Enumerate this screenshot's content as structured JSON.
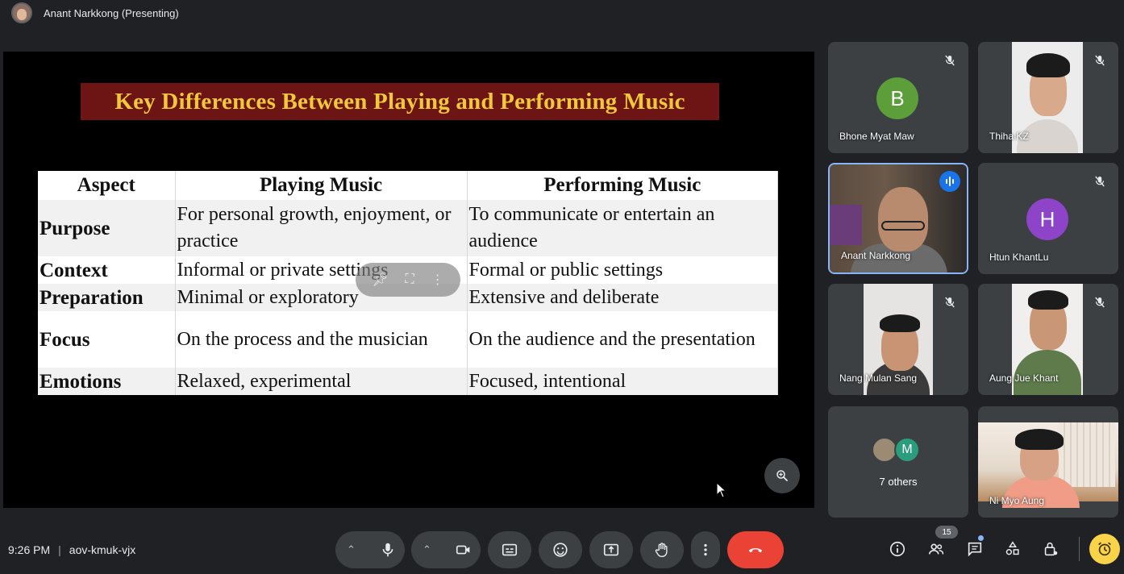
{
  "header": {
    "presenting_label": "Anant Narkkong (Presenting)"
  },
  "slide": {
    "title": "Key Differences Between Playing and Performing Music",
    "table": {
      "headers": [
        "Aspect",
        "Playing Music",
        "Performing Music"
      ],
      "rows": [
        {
          "aspect": "Purpose",
          "playing": "For personal growth, enjoyment, or practice",
          "performing": "To communicate or entertain an audience"
        },
        {
          "aspect": "Context",
          "playing": "Informal or private settings",
          "performing": "Formal or public settings"
        },
        {
          "aspect": "Preparation",
          "playing": "Minimal or exploratory",
          "performing": "Extensive and deliberate"
        },
        {
          "aspect": "Focus",
          "playing": "On the process and the musician",
          "performing": "On the audience and the presentation"
        },
        {
          "aspect": "Emotions",
          "playing": "Relaxed, experimental",
          "performing": "Focused, intentional"
        }
      ]
    }
  },
  "participants": [
    {
      "name": "Bhone Myat Maw",
      "initial": "B",
      "avatar_color": "#5b9e3a",
      "muted": true
    },
    {
      "name": "Thiha KZ",
      "muted": true,
      "video": true
    },
    {
      "name": "Anant Narkkong",
      "speaking": true,
      "video": true
    },
    {
      "name": "Htun KhantLu",
      "initial": "H",
      "avatar_color": "#8e44c9",
      "muted": true
    },
    {
      "name": "Nang Mulan Sang",
      "muted": true,
      "video": true
    },
    {
      "name": "Aung Jue Khant",
      "muted": true,
      "video": true
    },
    {
      "name": "Ni Myo Aung",
      "video": true
    }
  ],
  "others": {
    "label": "7 others",
    "avatar_initial": "M",
    "avatar_color": "#2a9d7c"
  },
  "meeting": {
    "time": "9:26 PM",
    "separator": "|",
    "code": "aov-kmuk-vjx"
  },
  "people_count": "15",
  "colors": {
    "end_call": "#ea4335",
    "active_speaker": "#8ab4f8",
    "timer": "#f9d34a"
  }
}
